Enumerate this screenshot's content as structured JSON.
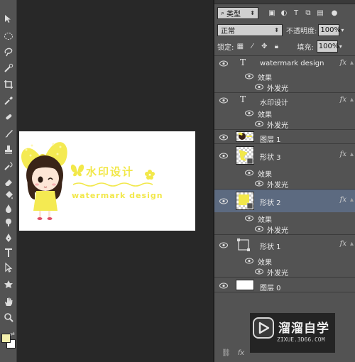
{
  "layers_panel": {
    "filter_label": "类型",
    "blend_mode": "正常",
    "opacity_label": "不透明度:",
    "opacity_value": "100%",
    "lock_label": "锁定:",
    "fill_label": "填充:",
    "fill_value": "100%",
    "effects_label": "效果",
    "outer_glow_label": "外发光",
    "fx_label": "fx",
    "layers": [
      {
        "name": "watermark design",
        "kind": "text",
        "has_effects": true,
        "effects": [
          "外发光"
        ]
      },
      {
        "name": "水印设计",
        "kind": "text",
        "has_effects": true,
        "effects": [
          "外发光"
        ]
      },
      {
        "name": "图层 1",
        "kind": "image",
        "has_effects": false
      },
      {
        "name": "形状 3",
        "kind": "shape",
        "has_effects": true,
        "effects": [
          "外发光"
        ]
      },
      {
        "name": "形状 2",
        "kind": "shape",
        "has_effects": true,
        "effects": [
          "外发光"
        ],
        "selected": true
      },
      {
        "name": "形状 1",
        "kind": "shape",
        "has_effects": true,
        "effects": [
          "外发光"
        ]
      },
      {
        "name": "图层 0",
        "kind": "fill",
        "has_effects": false
      }
    ]
  },
  "canvas": {
    "title_cn": "水印设计",
    "title_en": "watermark design"
  },
  "logo": {
    "main": "溜溜自学",
    "sub": "ZIXUE.3D66.COM"
  },
  "colors": {
    "accent_yellow": "#f2e84a",
    "selected_row": "#5c6a80",
    "panel_bg": "#535353",
    "foreground_swatch": "#f3efad",
    "background_swatch": "#ffffff"
  },
  "icons": {
    "toolbar": [
      "move-icon",
      "marquee-icon",
      "lasso-icon",
      "quick-select-icon",
      "crop-icon",
      "eyedropper-icon",
      "healing-icon",
      "brush-icon",
      "stamp-icon",
      "history-brush-icon",
      "eraser-icon",
      "paint-bucket-icon",
      "blur-icon",
      "dodge-icon",
      "pen-icon",
      "type-icon",
      "path-select-icon",
      "shape-icon",
      "hand-icon",
      "zoom-icon"
    ]
  }
}
